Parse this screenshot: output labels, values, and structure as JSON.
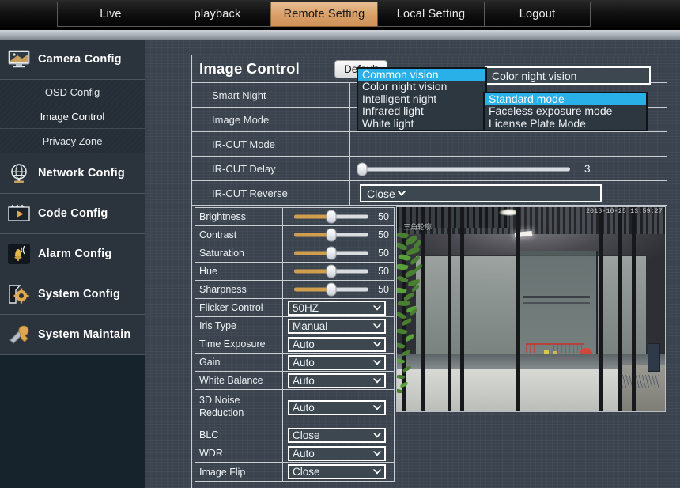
{
  "nav": {
    "tabs": [
      {
        "label": "Live",
        "active": false
      },
      {
        "label": "playback",
        "active": false
      },
      {
        "label": "Remote Setting",
        "active": true
      },
      {
        "label": "Local Setting",
        "active": false
      },
      {
        "label": "Logout",
        "active": false
      }
    ]
  },
  "sidebar": {
    "groups": [
      {
        "label": "Camera Config",
        "icon": "monitor-icon",
        "items": [
          {
            "label": "OSD Config",
            "active": false
          },
          {
            "label": "Image Control",
            "active": true
          },
          {
            "label": "Privacy Zone",
            "active": false
          }
        ]
      },
      {
        "label": "Network Config",
        "icon": "globe-icon",
        "items": []
      },
      {
        "label": "Code Config",
        "icon": "film-icon",
        "items": []
      },
      {
        "label": "Alarm Config",
        "icon": "bell-icon",
        "items": []
      },
      {
        "label": "System Config",
        "icon": "gear-icon",
        "items": []
      },
      {
        "label": "System Maintain",
        "icon": "wrench-icon",
        "items": []
      }
    ]
  },
  "panel": {
    "title": "Image Control",
    "default_button": "Default",
    "rows": [
      {
        "label": "Smart Night"
      },
      {
        "label": "Image Mode"
      },
      {
        "label": "IR-CUT Mode"
      },
      {
        "label": "IR-CUT Delay"
      },
      {
        "label": "IR-CUT Reverse"
      }
    ],
    "smart_night": {
      "selected_value": "Color night vision",
      "open": true,
      "options": [
        {
          "label": "Common vision",
          "selected": true
        },
        {
          "label": "Color night vision",
          "selected": false
        },
        {
          "label": "Intelligent night",
          "selected": false
        },
        {
          "label": "Infrared light",
          "selected": false
        },
        {
          "label": "White light",
          "selected": false
        }
      ]
    },
    "image_mode": {
      "open": true,
      "options": [
        {
          "label": "Standard mode",
          "selected": true
        },
        {
          "label": "Faceless exposure mode",
          "selected": false
        },
        {
          "label": "License Plate Mode",
          "selected": false
        }
      ]
    },
    "ircut_delay": {
      "value": "3",
      "percent": 2
    },
    "ircut_reverse": {
      "value": "Close"
    }
  },
  "settings": [
    {
      "label": "Brightness",
      "type": "slider",
      "value": "50",
      "percent": 50
    },
    {
      "label": "Contrast",
      "type": "slider",
      "value": "50",
      "percent": 50
    },
    {
      "label": "Saturation",
      "type": "slider",
      "value": "50",
      "percent": 50
    },
    {
      "label": "Hue",
      "type": "slider",
      "value": "50",
      "percent": 50
    },
    {
      "label": "Sharpness",
      "type": "slider",
      "value": "50",
      "percent": 50
    },
    {
      "label": "Flicker Control",
      "type": "select",
      "value": "50HZ"
    },
    {
      "label": "Iris Type",
      "type": "select",
      "value": "Manual"
    },
    {
      "label": "Time Exposure",
      "type": "select",
      "value": "Auto"
    },
    {
      "label": "Gain",
      "type": "select",
      "value": "Auto"
    },
    {
      "label": "White Balance",
      "type": "select",
      "value": "Auto"
    },
    {
      "label": "3D Noise Reduction",
      "type": "select",
      "value": "Auto",
      "two_line": true
    },
    {
      "label": "BLC",
      "type": "select",
      "value": "Close"
    },
    {
      "label": "WDR",
      "type": "select",
      "value": "Auto"
    },
    {
      "label": "Image Flip",
      "type": "select",
      "value": "Close"
    }
  ],
  "preview": {
    "timestamp": "2018-10-25 13:59:27",
    "watermark": "三角轮廓"
  },
  "colors": {
    "accent_tab": "#d99f67",
    "highlight": "#2ab0e8",
    "slider_fill": "#cf9f4e",
    "panel_bg": "#3b444e",
    "sidebar_bg": "#2b343d"
  }
}
